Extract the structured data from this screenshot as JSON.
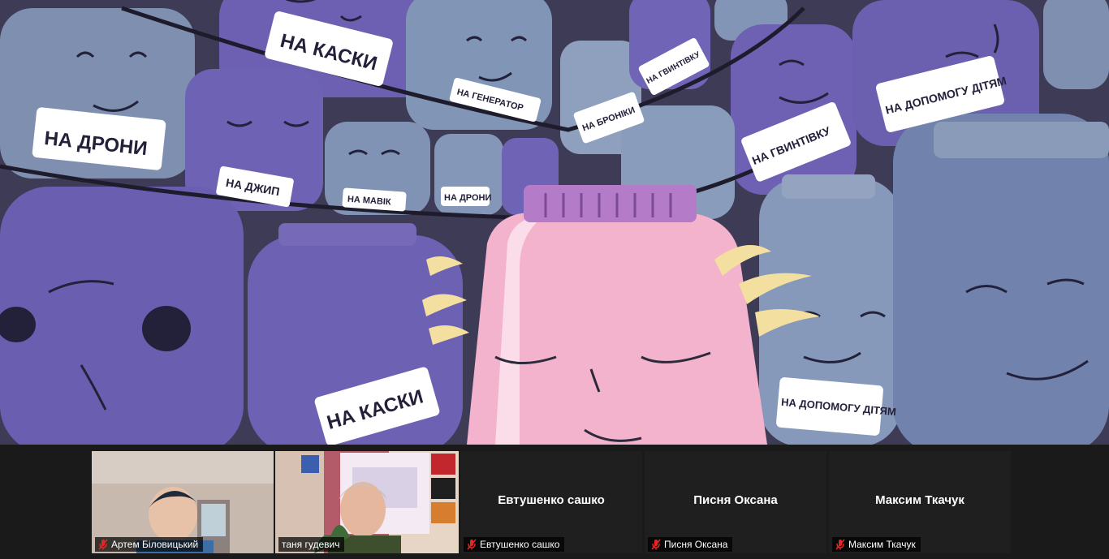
{
  "shared_screen": {
    "jar_labels": {
      "drones_top_left": "НА ДРОНИ",
      "helmets_top": "НА КАСКИ",
      "generator": "НА ГЕНЕРАТОР",
      "jeep": "НА ДЖИП",
      "mavic": "НА МАВІК",
      "drones_small": "НА ДРОНИ",
      "body_armor": "НА БРОНІКИ",
      "rifle_top": "НА ГВИНТІВКУ",
      "rifle_mid": "НА ГВИНТІВКУ",
      "help_children_top": "НА ДОПОМОГУ ДІТЯМ",
      "helmets_bottom": "НА КАСКИ",
      "help_children_bottom": "НА ДОПОМОГУ ДІТЯМ"
    }
  },
  "participants": [
    {
      "name": "Артем Біловицький",
      "muted": true,
      "video": true
    },
    {
      "name": "таня гудевич",
      "muted": false,
      "video": true,
      "active_speaker": true
    },
    {
      "name": "Евтушенко сашко",
      "muted": true,
      "video": false
    },
    {
      "name": "Писня Оксана",
      "muted": true,
      "video": false
    },
    {
      "name": "Максим Ткачук",
      "muted": true,
      "video": false
    }
  ],
  "colors": {
    "active_speaker_border": "#b6d94a",
    "muted_icon": "#e02828",
    "jar_purple": "#6f63b5",
    "jar_blue": "#8c9fc0",
    "hero_jar_pink": "#f4b3cc"
  }
}
